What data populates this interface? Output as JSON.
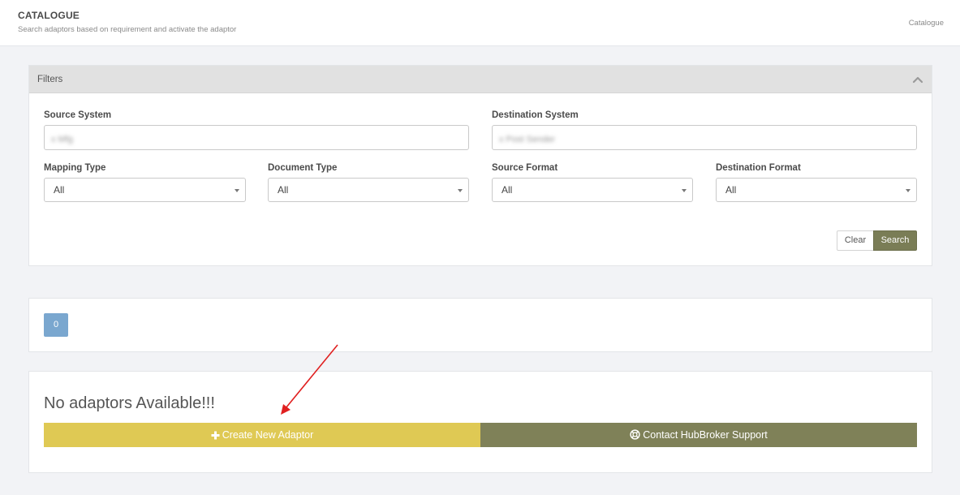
{
  "header": {
    "title": "CATALOGUE",
    "subtitle": "Search adaptors based on requirement and activate the adaptor",
    "breadcrumb": "Catalogue"
  },
  "filters": {
    "heading": "Filters",
    "source_system": {
      "label": "Source System",
      "value": "x Mfg"
    },
    "destination_system": {
      "label": "Destination System",
      "value": "x Post Sender"
    },
    "mapping_type": {
      "label": "Mapping Type",
      "value": "All"
    },
    "document_type": {
      "label": "Document Type",
      "value": "All"
    },
    "source_format": {
      "label": "Source Format",
      "value": "All"
    },
    "destination_format": {
      "label": "Destination Format",
      "value": "All"
    },
    "clear_label": "Clear",
    "search_label": "Search"
  },
  "results": {
    "count": "0",
    "empty_message": "No adaptors Available!!!",
    "create_label": "Create New Adaptor",
    "support_label": "Contact HubBroker Support"
  },
  "colors": {
    "accent_olive": "#7a7d56",
    "create_yellow": "#dfc954",
    "badge_blue": "#7aa7cf",
    "annotation_arrow": "#e02020"
  },
  "icons": {
    "collapse": "chevron-up-icon",
    "create": "plus-icon",
    "support": "lifebuoy-icon"
  }
}
